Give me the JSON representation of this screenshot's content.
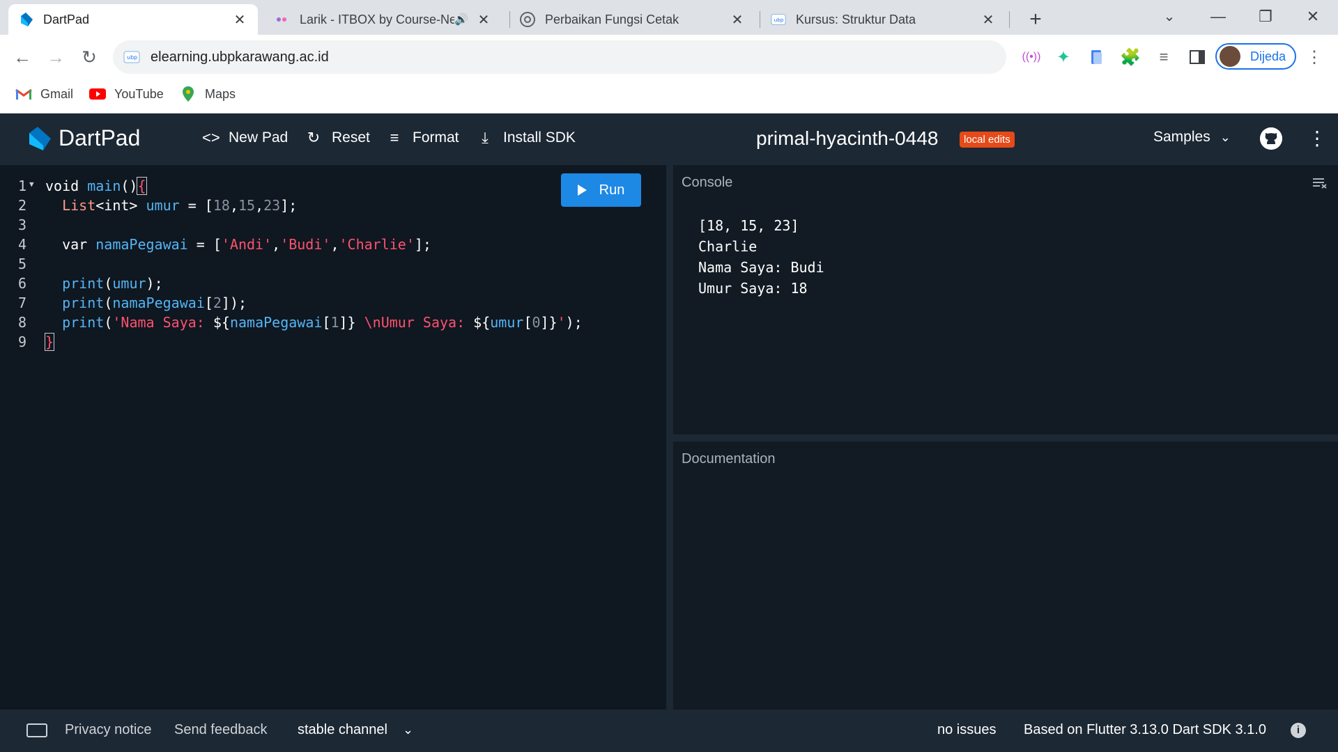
{
  "browser": {
    "tabs": [
      {
        "title": "DartPad",
        "active": true,
        "favicon": "dart-logo"
      },
      {
        "title": "Larik - ITBOX by Course-Net",
        "active": false,
        "favicon": "itbox-logo",
        "audio": true
      },
      {
        "title": "Perbaikan Fungsi Cetak",
        "active": false,
        "favicon": "chatgpt-logo"
      },
      {
        "title": "Kursus: Struktur Data",
        "active": false,
        "favicon": "ubp-logo"
      }
    ],
    "url": "elearning.ubpkarawang.ac.id",
    "profile_name": "Dijeda",
    "bookmarks": [
      {
        "label": "Gmail",
        "icon": "gmail-icon"
      },
      {
        "label": "YouTube",
        "icon": "youtube-icon"
      },
      {
        "label": "Maps",
        "icon": "maps-icon"
      }
    ]
  },
  "dartpad": {
    "title": "DartPad",
    "actions": {
      "new_pad": "New Pad",
      "reset": "Reset",
      "format": "Format",
      "install_sdk": "Install SDK"
    },
    "pad_name": "primal-hyacinth-0448",
    "badge": "local edits",
    "samples": "Samples",
    "run": "Run"
  },
  "editor": {
    "line_numbers": [
      "1",
      "2",
      "3",
      "4",
      "5",
      "6",
      "7",
      "8",
      "9"
    ]
  },
  "console": {
    "label": "Console",
    "output": [
      "[18, 15, 23]",
      "Charlie",
      "Nama Saya: Budi",
      "Umur Saya: 18"
    ]
  },
  "documentation": {
    "label": "Documentation"
  },
  "status": {
    "privacy": "Privacy notice",
    "feedback": "Send feedback",
    "channel": "stable channel",
    "issues": "no issues",
    "version": "Based on Flutter 3.13.0 Dart SDK 3.1.0"
  },
  "colors": {
    "header_bg": "#1c2834",
    "editor_bg": "#0f1720",
    "run_button": "#1e88e5",
    "badge": "#e64a19"
  }
}
